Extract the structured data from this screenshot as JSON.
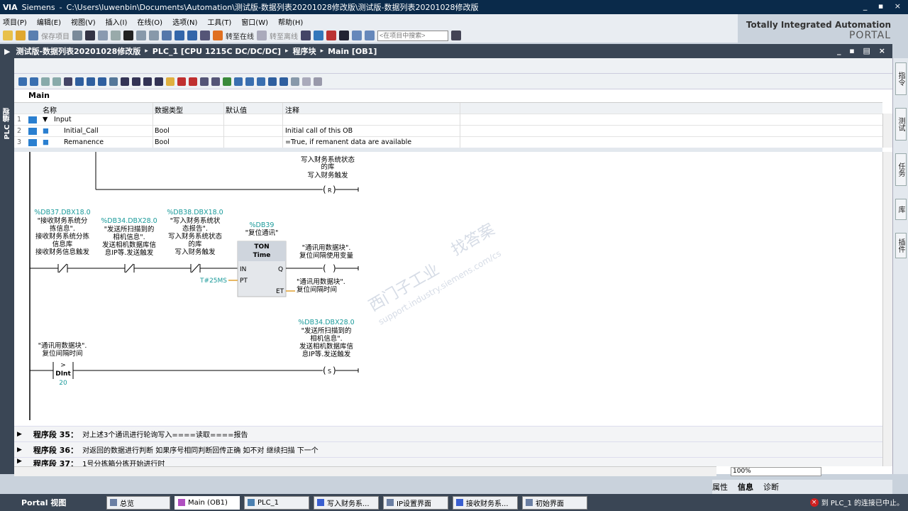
{
  "window": {
    "app": "Siemens",
    "path": "C:\\Users\\luwenbin\\Documents\\Automation\\测试版-数据列表20201028修改版\\测试版-数据列表20201028修改版",
    "controls": "_ ▪ ×"
  },
  "menu": [
    "项目(P)",
    "编辑(E)",
    "视图(V)",
    "插入(I)",
    "在线(O)",
    "选项(N)",
    "工具(T)",
    "窗口(W)",
    "帮助(H)"
  ],
  "toolbar": {
    "save": "保存项目",
    "go_online": "转至在线",
    "go_offline": "转至离线",
    "search_placeholder": "<在项目中搜索>"
  },
  "brand": {
    "line1": "Totally Integrated Automation",
    "line2": "PORTAL"
  },
  "breadcrumb": [
    "测试版-数据列表20201028修改版",
    "PLC_1 [CPU 1215C DC/DC/DC]",
    "程序块",
    "Main [OB1]"
  ],
  "left_tab": "PLC 编程",
  "right_tabs": [
    "指令",
    "测试",
    "任务",
    "库",
    "插件"
  ],
  "block": {
    "name": "Main"
  },
  "interface": {
    "headers": {
      "name": "名称",
      "type": "数据类型",
      "default": "默认值",
      "comment": "注释"
    },
    "rows": [
      {
        "num": "1",
        "name": "Input",
        "type": "",
        "comment": ""
      },
      {
        "num": "2",
        "name": "Initial_Call",
        "type": "Bool",
        "comment": "Initial call of this OB"
      },
      {
        "num": "3",
        "name": "Remanence",
        "type": "Bool",
        "comment": "=True, if remanent data are available"
      }
    ]
  },
  "ladder": {
    "top_coil": {
      "label1": "写入财务系统状态",
      "label2": "的库",
      "label3": "写入财务触发",
      "type": "R"
    },
    "c1": {
      "addr": "%DB37.DBX18.0",
      "l1": "\"接收财务系统分",
      "l2": "拣信息\".",
      "l3": "接收财务系统分拣",
      "l4": "信息库",
      "l5": "接收财务信息触发"
    },
    "c2": {
      "addr": "%DB34.DBX28.0",
      "l1": "\"发送所扫描到的",
      "l2": "相机信息\".",
      "l3": "发送相机数据库信",
      "l4": "息IP等.发送触发"
    },
    "c3": {
      "addr": "%DB38.DBX18.0",
      "l1": "\"写入财务系统状",
      "l2": "态报告\".",
      "l3": "写入财务系统状态",
      "l4": "的库",
      "l5": "写入财务触发"
    },
    "timer": {
      "db": "%DB39",
      "name": "\"复位通讯\"",
      "type": "TON",
      "subtype": "Time",
      "in": "IN",
      "q": "Q",
      "pt": "PT",
      "et": "ET",
      "pt_val": "T#25MS"
    },
    "q_coil": {
      "l1": "\"通讯用数据块\".",
      "l2": "复位间隔使用变量"
    },
    "et_out": {
      "l1": "\"通讯用数据块\".",
      "l2": "复位间隔时间"
    },
    "cmp": {
      "l1": "\"通讯用数据块\".",
      "l2": "复位间隔时间",
      "op": ">",
      "type": "DInt",
      "val": "20"
    },
    "s_coil": {
      "addr": "%DB34.DBX28.0",
      "l1": "\"发送所扫描到的",
      "l2": "相机信息\".",
      "l3": "发送相机数据库信",
      "l4": "息IP等.发送触发",
      "type": "S"
    },
    "watermark": {
      "l1": "西门子工业",
      "l2": "support.industry.siemens.com/cs",
      "l3": "找答案"
    }
  },
  "segments": [
    {
      "title": "程序段 35：",
      "desc": "对上述3个通讯进行轮询写入====读取====报告"
    },
    {
      "title": "程序段 36：",
      "desc": "对返回的数据进行判断 如果序号相同判断回传正确 如不对 继续扫描 下一个"
    },
    {
      "title": "程序段 37：",
      "desc": "1号分拣箱分拣开始进行时"
    }
  ],
  "zoom": "100%",
  "inspector": {
    "props": "属性",
    "info": "信息",
    "diag": "诊断"
  },
  "taskbar": {
    "portal": "Portal 视图",
    "tasks": [
      "总览",
      "Main (OB1)",
      "PLC_1",
      "写入财务系...",
      "IP设置界面",
      "接收财务系...",
      "初始界面"
    ],
    "status": "到 PLC_1 的连接已中止。"
  },
  "colors": {
    "accent": "#0a2a4a",
    "addr": "#1a9a9a",
    "bar": "#3a4655"
  }
}
